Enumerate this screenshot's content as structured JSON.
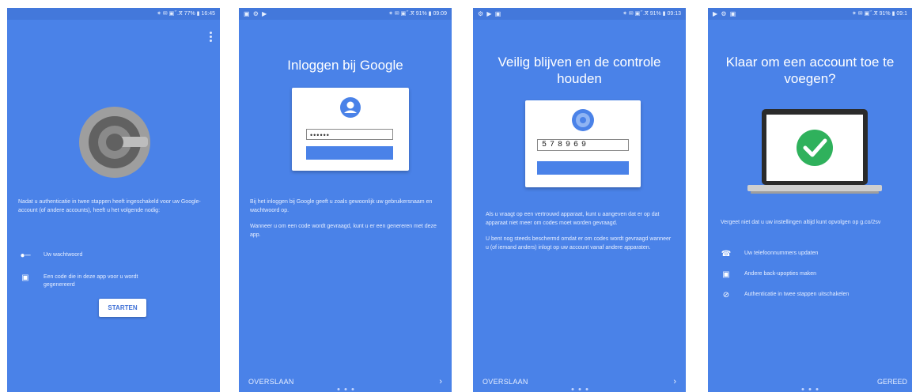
{
  "colors": {
    "primary": "#4a82e8",
    "statusbar": "#4378db",
    "success": "#2fb15c"
  },
  "screens": [
    {
      "status_left": "",
      "status_right": "✶ ✉ ▣ ⷵ .ⴳ 77% ▮ 16:45",
      "intro": "Nadat u authenticatie in twee stappen heeft ingeschakeld voor uw Google-account (of andere accounts), heeft u het volgende nodig:",
      "items": [
        {
          "icon": "key-icon",
          "text": "Uw wachtwoord"
        },
        {
          "icon": "lock-icon",
          "text": "Een code die in deze app voor u wordt gegenereerd"
        }
      ],
      "button": "STARTEN"
    },
    {
      "status_left": "▣ ⚙ ▶",
      "status_right": "✶ ✉ ▣ ⷵ .ⴳ 91% ▮ 09:09",
      "title": "Inloggen bij Google",
      "password_mask": "••••••",
      "paragraphs": [
        "Bij het inloggen bij Google geeft u zoals gewoonlijk uw gebruikersnaam en wachtwoord op.",
        "Wanneer u om een code wordt gevraagd, kunt u er een genereren met deze app."
      ],
      "skip": "OVERSLAAN",
      "next": "›"
    },
    {
      "status_left": "⚙ ▶ ▣",
      "status_right": "✶ ✉ ▣ ⷵ .ⴳ 91% ▮ 09:13",
      "title": "Veilig blijven en de controle houden",
      "code": "578969",
      "paragraphs": [
        "Als u vraagt op een vertrouwd apparaat, kunt u aangeven dat er op dat apparaat niet meer om codes moet worden gevraagd.",
        "U bent nog steeds beschermd omdat er om codes wordt gevraagd wanneer u (of iemand anders) inlogt op uw account vanaf andere apparaten."
      ],
      "skip": "OVERSLAAN",
      "next": "›"
    },
    {
      "status_left": "▶ ⚙ ▣",
      "status_right": "✶ ✉ ▣ ⷵ .ⴳ 91% ▮ 09:1",
      "title": "Klaar om een account toe te voegen?",
      "intro": "Vergeet niet dat u uw instellingen altijd kunt opvolgen op g.co/2sv",
      "items": [
        {
          "icon": "phone-icon",
          "text": "Uw telefoonnummers updaten"
        },
        {
          "icon": "lock-icon",
          "text": "Andere back-upopties maken"
        },
        {
          "icon": "block-icon",
          "text": "Authenticatie in twee stappen uitschakelen"
        }
      ],
      "done": "GEREED"
    }
  ]
}
